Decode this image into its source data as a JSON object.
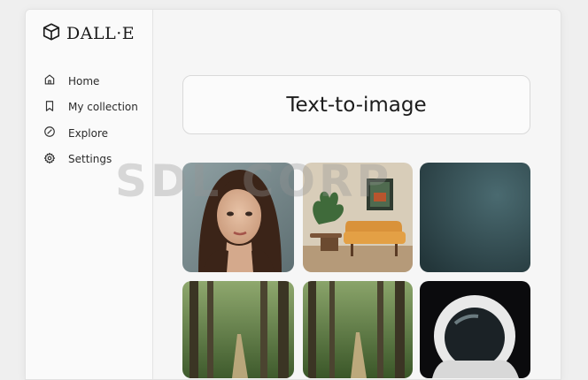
{
  "app": {
    "name": "DALL·E",
    "logo_icon": "cube-icon"
  },
  "sidebar": {
    "items": [
      {
        "label": "Home",
        "icon": "home-icon"
      },
      {
        "label": "My collection",
        "icon": "bookmark-icon"
      },
      {
        "label": "Explore",
        "icon": "compass-icon"
      },
      {
        "label": "Settings",
        "icon": "gear-icon"
      }
    ]
  },
  "main": {
    "prompt_title": "Text-to-image",
    "gallery": [
      {
        "subject": "portrait of a woman"
      },
      {
        "subject": "orange armchair with plant and framed picture"
      },
      {
        "subject": "dark teal gradient"
      },
      {
        "subject": "forest path"
      },
      {
        "subject": "forest path"
      },
      {
        "subject": "astronaut helmet"
      }
    ]
  },
  "watermark": "SDL CORP"
}
